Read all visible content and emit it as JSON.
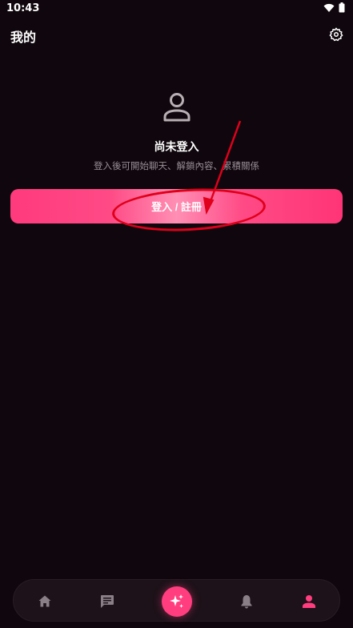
{
  "status_bar": {
    "time": "10:43"
  },
  "header": {
    "title": "我的"
  },
  "profile": {
    "title": "尚未登入",
    "subtitle": "登入後可開始聊天、解鎖內容、累積關係"
  },
  "login_button": {
    "label": "登入 / 註冊"
  },
  "colors": {
    "background": "#0f070d",
    "accent": "#ff3d7f",
    "nav_active": "#ff3d7f",
    "nav_inactive": "#8a7f86",
    "annotation": "#e0001b"
  },
  "bottom_nav": {
    "items": [
      {
        "icon": "home-icon",
        "active": false
      },
      {
        "icon": "chat-icon",
        "active": false
      },
      {
        "icon": "sparkle-icon",
        "active": true
      },
      {
        "icon": "bell-icon",
        "active": false
      },
      {
        "icon": "person-icon",
        "active": true
      }
    ]
  }
}
